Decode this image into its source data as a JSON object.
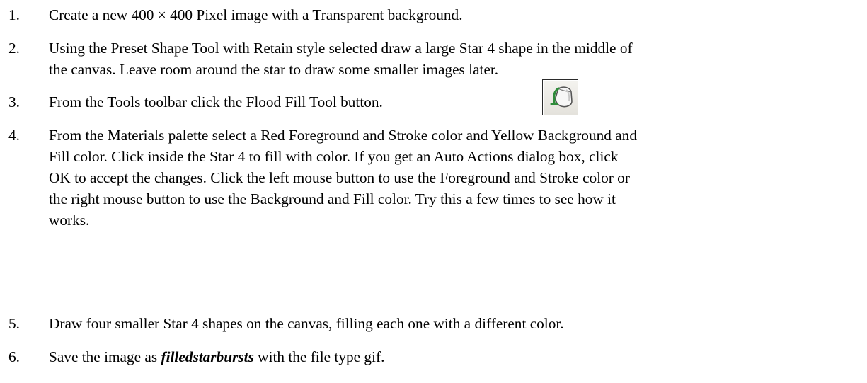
{
  "steps": [
    {
      "number": "1.",
      "lines": [
        "Create a new 400 × 400 Pixel image with a Transparent background."
      ]
    },
    {
      "number": "2.",
      "lines": [
        "Using the Preset Shape Tool with Retain style selected draw a large Star 4 shape in the middle of",
        "the canvas. Leave room around the star to draw some smaller images later."
      ]
    },
    {
      "number": "3.",
      "lines": [
        "From the Tools toolbar click the Flood Fill Tool button."
      ],
      "icon": "flood-fill-icon"
    },
    {
      "number": "4.",
      "lines": [
        "From the Materials palette select a Red Foreground and Stroke color and Yellow Background and",
        "Fill color. Click inside the Star 4 to fill with color. If you get an Auto Actions dialog box, click",
        "OK to accept the changes. Click the left mouse button to use the Foreground and Stroke color or",
        "the right mouse button to use the Background and Fill color. Try this a few times to see how it",
        "works."
      ]
    },
    {
      "number": "5.",
      "lines": [
        "Draw four smaller Star 4 shapes on the canvas, filling each one with a different color."
      ]
    },
    {
      "number": "6.",
      "prefix": "Save the image as ",
      "emphasis": "filledstarbursts",
      "suffix": " with the file type gif."
    }
  ],
  "colors": {
    "text": "#000000",
    "background": "#ffffff",
    "icon_bucket": "#2e8b3a"
  }
}
